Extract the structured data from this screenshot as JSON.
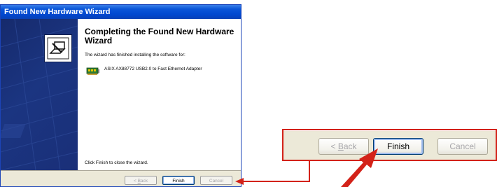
{
  "window": {
    "title": "Found New Hardware Wizard"
  },
  "content": {
    "heading": "Completing the Found New Hardware Wizard",
    "description": "The wizard has finished installing the software for:",
    "device_name": "ASIX AX88772 USB2.0 to Fast Ethernet Adapter",
    "footer": "Click Finish to close the wizard."
  },
  "buttons": {
    "back_label": "< Back",
    "finish_label": "Finish",
    "cancel_label": "Cancel",
    "back_enabled": false,
    "finish_enabled": true,
    "cancel_enabled": false
  },
  "callout": {
    "back_label": "< Back",
    "finish_label": "Finish",
    "cancel_label": "Cancel"
  },
  "colors": {
    "titlebar": "#0a55d8",
    "banner": "#1b3581",
    "button_face": "#ece9d8",
    "highlight": "#d32219"
  },
  "icons": {
    "hardware_image": "hardware-install-icon",
    "device": "network-adapter-icon",
    "pointer": "red-arrow-icon"
  }
}
